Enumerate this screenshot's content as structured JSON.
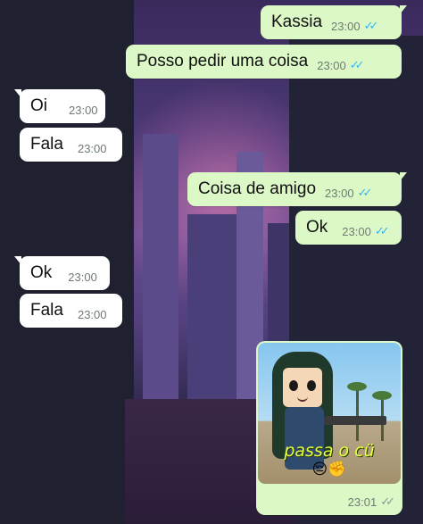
{
  "chat": {
    "messages": [
      {
        "direction": "outgoing",
        "text": "Kassia",
        "time": "23:00",
        "status": "read"
      },
      {
        "direction": "outgoing",
        "text": "Posso pedir uma coisa",
        "time": "23:00",
        "status": "read"
      },
      {
        "direction": "incoming",
        "text": "Oi",
        "time": "23:00"
      },
      {
        "direction": "incoming",
        "text": "Fala",
        "time": "23:00"
      },
      {
        "direction": "outgoing",
        "text": "Coisa de amigo",
        "time": "23:00",
        "status": "read"
      },
      {
        "direction": "outgoing",
        "text": "Ok",
        "time": "23:00",
        "status": "read"
      },
      {
        "direction": "incoming",
        "text": "Ok",
        "time": "23:00"
      },
      {
        "direction": "incoming",
        "text": "Fala",
        "time": "23:00"
      }
    ],
    "image_message": {
      "caption": "passa o cü",
      "emojis": "😔✊",
      "time": "23:01",
      "status": "delivered"
    }
  },
  "colors": {
    "outgoing_bubble": "#dcf8c6",
    "incoming_bubble": "#ffffff",
    "read_ticks": "#34b7f1",
    "delivered_ticks": "#8c9a91"
  }
}
